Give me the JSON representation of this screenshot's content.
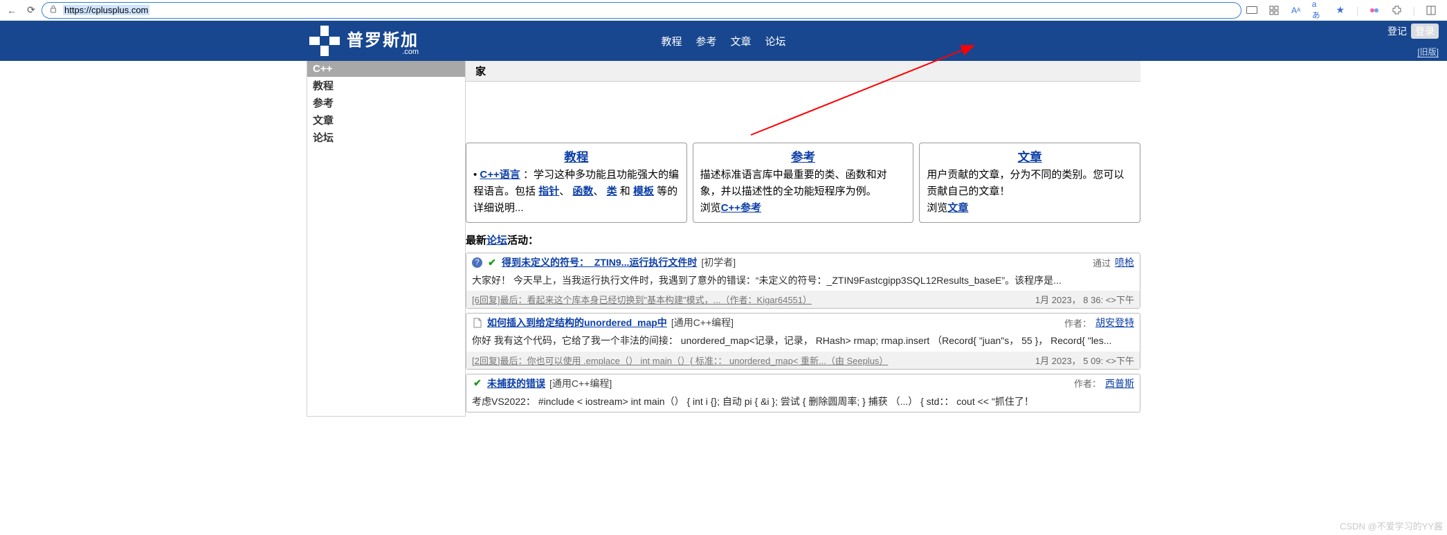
{
  "browser": {
    "url": "https://cplusplus.com",
    "right_icons": [
      "screen-icon",
      "grid-icon",
      "text-size-icon",
      "translate-icon",
      "star-icon",
      "copilot-icon",
      "extensions-icon",
      "split-icon"
    ],
    "translate_label": "aあ"
  },
  "header": {
    "logo_text": "普罗斯加",
    "logo_com": ".com",
    "nav": [
      "教程",
      "参考",
      "文章",
      "论坛"
    ],
    "register": "登记",
    "login": "登录",
    "legacy": "[旧版]"
  },
  "sidebar": {
    "head": "C++",
    "items": [
      "教程",
      "参考",
      "文章",
      "论坛"
    ]
  },
  "crumb": "家",
  "cards": [
    {
      "title": "教程",
      "body_pre": "C++语言",
      "body_mid": "：学习这种多功能且功能强大的编程语言。包括",
      "links": [
        "指针",
        "函数",
        "类"
      ],
      "joiner": "和",
      "link_last": "模板",
      "body_post": "等的详细说明..."
    },
    {
      "title": "参考",
      "body": "描述标准语言库中最重要的类、函数和对象，并以描述性的全功能短程序为例。",
      "cta_pre": "浏览",
      "cta_link": "C++参考"
    },
    {
      "title": "文章",
      "body": "用户贡献的文章，分为不同的类别。您可以贡献自己的文章！",
      "cta_pre": "浏览",
      "cta_link": "文章"
    }
  ],
  "forum_head_pre": "最新",
  "forum_head_link": "论坛",
  "forum_head_post": "活动：",
  "threads": [
    {
      "icons": [
        "qmark",
        "tick"
      ],
      "title": "得到未定义的符号：_ZTIN9...运行执行文件时",
      "cat": "[初学者]",
      "by_label": "通过",
      "author": "喷枪",
      "body": "大家好！ 今天早上，当我运行执行文件时，我遇到了意外的错误：“未定义的符号：_ZTIN9Fastcgipp3SQL12Results_baseE”。该程序是...",
      "meta": "[6回复]最后：看起来这个库本身已经切换到\"基本构建\"模式，...（作者：Kigar64551）",
      "ts": "1月 2023， 8 36: <>下午"
    },
    {
      "icons": [
        "doc"
      ],
      "title": "如何插入到给定结构的unordered_map中",
      "cat": "[通用C++编程]",
      "by_label": "作者：",
      "author": "胡安登特",
      "body": "你好 我有这个代码，它给了我一个非法的间接： unordered_map<记录，记录， RHash> rmap; rmap.insert （Record{ \"juan\"s，  55 }， Record{ \"les...",
      "meta": "[2回复]最后：你也可以使用 .emplace（） int main（）{ 标准：： unordered_map< 重新...（由 Seeplus）",
      "ts": "1月 2023， 5 09: <>下午"
    },
    {
      "icons": [
        "tick"
      ],
      "title": "未捕获的错误",
      "cat": "[通用C++编程]",
      "by_label": "作者：",
      "author": "西普斯",
      "body": "考虑VS2022：  #include < iostream> int main（） { int i {}; 自动 pi { &i }; 尝试 { 删除圆周率; } 捕获 （...） { std：： cout << \"抓住了！",
      "meta": "",
      "ts": ""
    }
  ],
  "watermark": "CSDN @不爱学习的YY酱"
}
